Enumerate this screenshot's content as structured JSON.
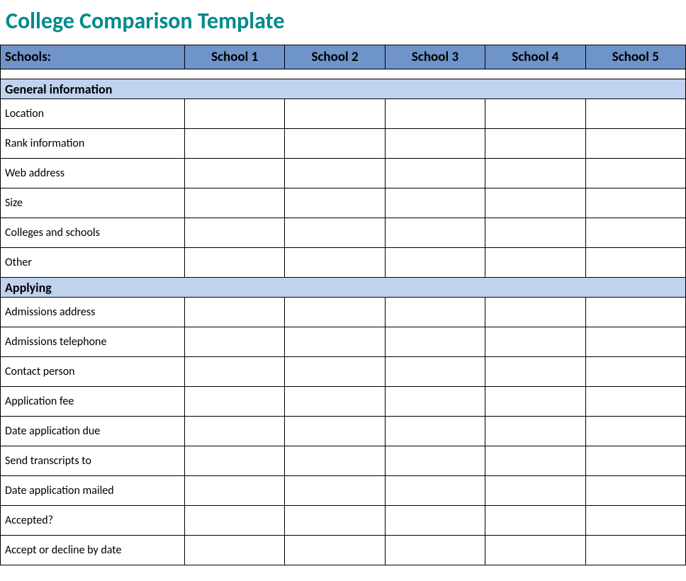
{
  "title": "College Comparison Template",
  "header": {
    "schools_label": "Schools:",
    "columns": [
      "School 1",
      "School 2",
      "School 3",
      "School 4",
      "School 5"
    ]
  },
  "sections": [
    {
      "title": "General information",
      "rows": [
        "Location",
        "Rank information",
        "Web address",
        "Size",
        "Colleges and schools",
        "Other"
      ]
    },
    {
      "title": "Applying",
      "rows": [
        "Admissions address",
        "Admissions telephone",
        "Contact person",
        "Application fee",
        "Date application due",
        "Send transcripts to",
        "Date application mailed",
        "Accepted?",
        "Accept or decline by date"
      ]
    }
  ]
}
